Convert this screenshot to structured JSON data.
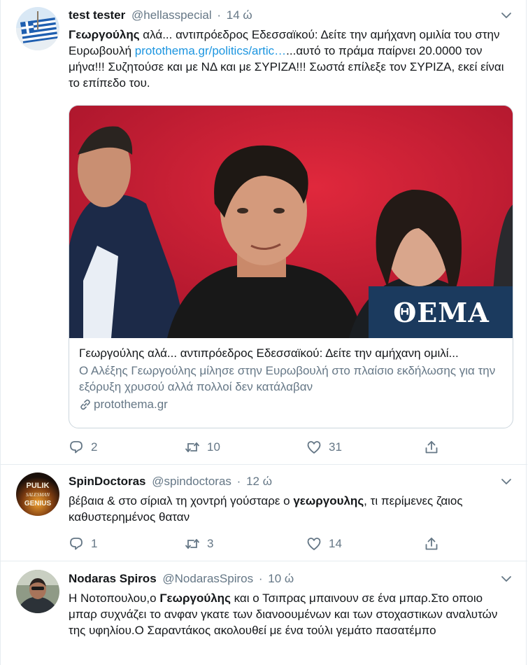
{
  "tweets": [
    {
      "name": "test tester",
      "handle": "@hellasspecial",
      "dot": "·",
      "time": "14 ώ",
      "text": {
        "bold_lead": "Γεωργούλης",
        "part1": " αλά... αντιπρόεδρος Εδεσσαϊκού: Δείτε την αμήχανη ομιλία του στην Ευρωβουλή ",
        "link": "protothema.gr/politics/artic…",
        "part2": "...αυτό το πράμα παίρνει 20.0000 τον μήνα!!! Συζητούσε και με ΝΔ και με ΣΥΡΙΖΑ!!! Σωστά επίλεξε τον ΣΥΡΙΖΑ, εκεί είναι το επίπεδο του."
      },
      "card": {
        "badge": "ΘΕΜΑ",
        "title": "Γεωργούλης αλά... αντιπρόεδρος Εδεσσαϊκού: Δείτε την αμήχανη ομιλί...",
        "description": "Ο Αλέξης Γεωργούλης μίλησε στην Ευρωβουλή στο πλαίσιο εκδήλωσης για την εξόρυξη χρυσού αλλά πολλοί δεν κατάλαβαν",
        "domain": "protothema.gr"
      },
      "replies": "2",
      "retweets": "10",
      "likes": "31"
    },
    {
      "name": "SpinDoctoras",
      "handle": "@spindoctoras",
      "dot": "·",
      "time": "12 ώ",
      "avatar_text": [
        "PULIK",
        "SALESMAN",
        "GENIUS"
      ],
      "text": {
        "part1": "βέβαια & στο σίριαλ τη χοντρή γούσταρε ο ",
        "bold": "γεωργουλης",
        "part2": ", τι περίμενες ζαιος καθυστερημένος θαταν"
      },
      "replies": "1",
      "retweets": "3",
      "likes": "14"
    },
    {
      "name": "Nodaras Spiros",
      "handle": "@NodarasSpiros",
      "dot": "·",
      "time": "10 ώ",
      "text": {
        "part1": "Η Νοτοπουλου,ο ",
        "bold": "Γεωργούλης",
        "part2": " και ο Τσιπρας μπαινουν σε ένα μπαρ.Στο οποιο μπαρ συχνάζει το ανφαν γκατε των διανοουμένων και των στοχαστικων αναλυτών της υφηλίου.Ο Σαραντάκος ακολουθεί με ένα τούλι γεμάτο πασατέμπο"
      }
    }
  ],
  "colors": {
    "text": "#14171a",
    "secondary": "#657786",
    "link": "#1b95e0",
    "border": "#e6ecf0",
    "card_border": "#ccd6dd",
    "card_bg_red": "#c41c2f",
    "badge_bg": "#1b3a5e"
  },
  "icons": [
    "caret-down-icon",
    "reply-icon",
    "retweet-icon",
    "like-icon",
    "share-icon",
    "link-icon"
  ]
}
